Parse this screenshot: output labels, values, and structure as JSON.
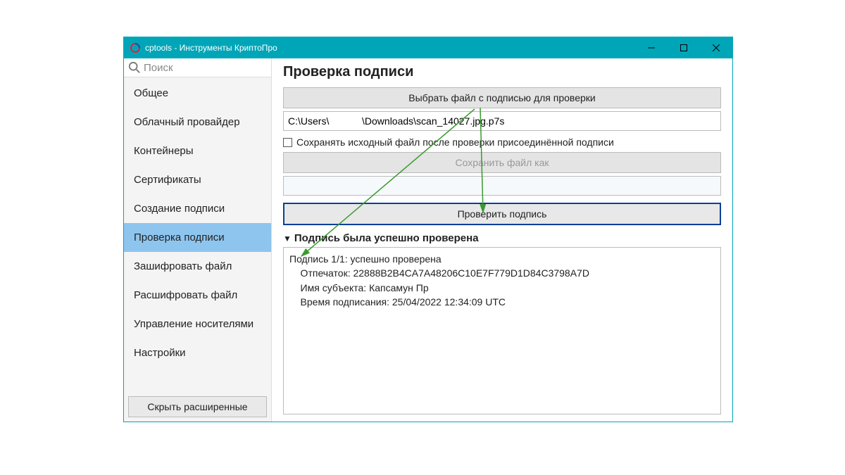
{
  "window": {
    "title": "cptools - Инструменты КриптоПро"
  },
  "search": {
    "placeholder": "Поиск"
  },
  "sidebar": {
    "items": [
      {
        "label": "Общее"
      },
      {
        "label": "Облачный провайдер"
      },
      {
        "label": "Контейнеры"
      },
      {
        "label": "Сертификаты"
      },
      {
        "label": "Создание подписи"
      },
      {
        "label": "Проверка подписи"
      },
      {
        "label": "Зашифровать файл"
      },
      {
        "label": "Расшифровать файл"
      },
      {
        "label": "Управление носителями"
      },
      {
        "label": "Настройки"
      }
    ],
    "active_index": 5,
    "hide_extended_label": "Скрыть расширенные"
  },
  "main": {
    "title": "Проверка подписи",
    "select_file_label": "Выбрать файл с подписью для проверки",
    "file_path": "C:\\Users\\            \\Downloads\\scan_14027.jpg.p7s",
    "checkbox_label": "Сохранять исходный файл после проверки присоединённой подписи",
    "checkbox_checked": false,
    "save_as_label": "Сохранить файл как",
    "save_as_path": "",
    "verify_label": "Проверить подпись",
    "result_title": "Подпись была успешно проверена",
    "result_body": "Подпись 1/1: успешно проверена\n    Отпечаток: 22888B2B4CA7A48206C10E7F779D1D84C3798A7D\n    Имя субъекта: Капсамун Пр\n    Время подписания: 25/04/2022 12:34:09 UTC"
  }
}
